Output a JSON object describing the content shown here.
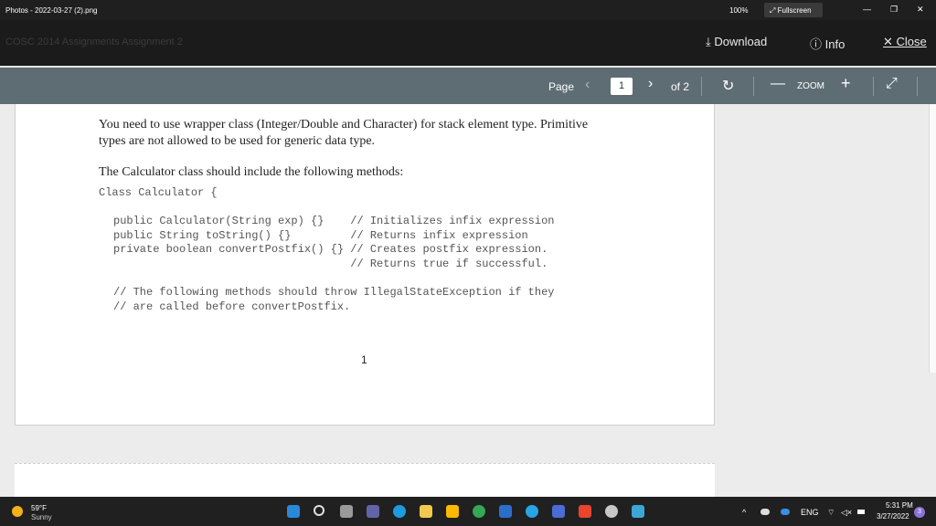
{
  "titlebar": {
    "app_title": "Photos - 2022-03-27 (2).png",
    "zoom": "100%",
    "fullscreen": "⤢ Fullscreen",
    "minimize": "—",
    "restore": "❐",
    "close": "✕"
  },
  "viewer": {
    "breadcrumb_ghost": "COSC 2014   Assignments   Assignment 2",
    "download": "⤓ Download",
    "info": "ⓘ Info",
    "close": "✕ Close"
  },
  "pdf_toolbar": {
    "page_label": "Page",
    "prev": "‹",
    "current_page": "1",
    "next": "›",
    "total_pages": "of 2",
    "rotate": "↻",
    "zoom_out": "—",
    "zoom_label": "ZOOM",
    "zoom_in": "+",
    "expand": "⤢"
  },
  "document": {
    "para1_line1": "You need to use wrapper class (Integer/Double and Character) for stack element type. Primitive",
    "para1_line2": "types are not allowed to be used for generic data type.",
    "para2": "The Calculator class should include the following methods:",
    "class_decl": "Class Calculator {",
    "code_lines": [
      "public Calculator(String exp) {}    // Initializes infix expression",
      "public String toString() {}         // Returns infix expression",
      "private boolean convertPostfix() {} // Creates postfix expression.",
      "                                    // Returns true if successful."
    ],
    "comment_lines": [
      "// The following methods should throw IllegalStateException if they",
      "// are called before convertPostfix."
    ],
    "page_number": "1"
  },
  "taskbar": {
    "temperature": "59°F",
    "condition": "Sunny",
    "language": "ENG",
    "time": "5:31 PM",
    "date": "3/27/2022",
    "notifications": "3",
    "colors": {
      "start": "#2b88d8",
      "search": "#e0e0e0",
      "taskview": "#9a9a9a",
      "teams": "#6264a7",
      "edge": "#1e9be0",
      "explorer": "#f2c94c",
      "store": "#ffb900",
      "chrome": "#34a853",
      "mail": "#2b6ecb",
      "cortana": "#29a5e6",
      "vscode": "#4b6bd6",
      "office": "#e8452c",
      "settings": "#c7c7c7",
      "photos": "#3ba7d9"
    }
  }
}
